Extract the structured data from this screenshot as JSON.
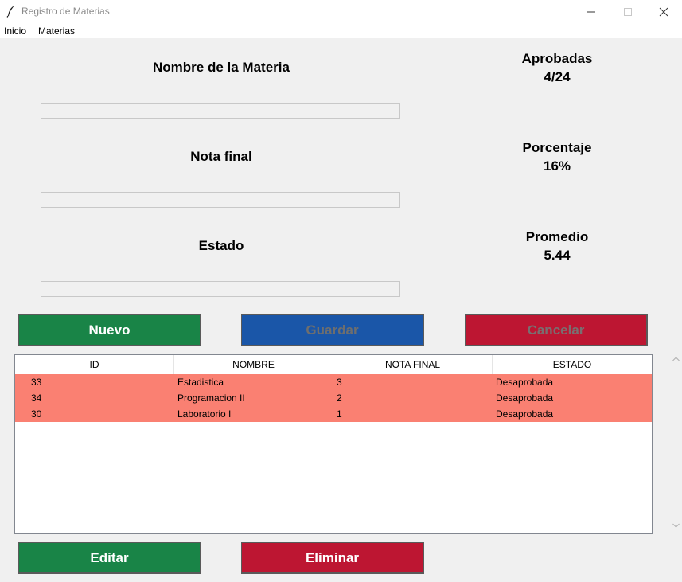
{
  "window": {
    "title": "Registro de Materias"
  },
  "menu": {
    "items": [
      "Inicio",
      "Materias"
    ]
  },
  "form": {
    "nombre_label": "Nombre de la Materia",
    "nombre_value": "",
    "nota_label": "Nota final",
    "nota_value": "",
    "estado_label": "Estado",
    "estado_value": ""
  },
  "stats": {
    "aprobadas_label": "Aprobadas",
    "aprobadas_value": "4/24",
    "porcentaje_label": "Porcentaje",
    "porcentaje_value": "16%",
    "promedio_label": "Promedio",
    "promedio_value": "5.44"
  },
  "buttons": {
    "nuevo": "Nuevo",
    "guardar": "Guardar",
    "cancelar": "Cancelar",
    "editar": "Editar",
    "eliminar": "Eliminar"
  },
  "table": {
    "columns": [
      "ID",
      "NOMBRE",
      "NOTA FINAL",
      "ESTADO"
    ],
    "rows": [
      {
        "id": "33",
        "nombre": "Estadistica",
        "nota": "3",
        "estado": "Desaprobada"
      },
      {
        "id": "34",
        "nombre": "Programacion II",
        "nota": "2",
        "estado": "Desaprobada"
      },
      {
        "id": "30",
        "nombre": "Laboratorio I",
        "nota": "1",
        "estado": "Desaprobada"
      }
    ],
    "row_color": "#fa8072"
  },
  "colors": {
    "green": "#198447",
    "blue": "#1a56a8",
    "red": "#bd1632"
  },
  "icons": [
    "feather-icon",
    "minimize-icon",
    "maximize-icon",
    "close-icon",
    "scroll-up-icon",
    "scroll-down-icon"
  ]
}
